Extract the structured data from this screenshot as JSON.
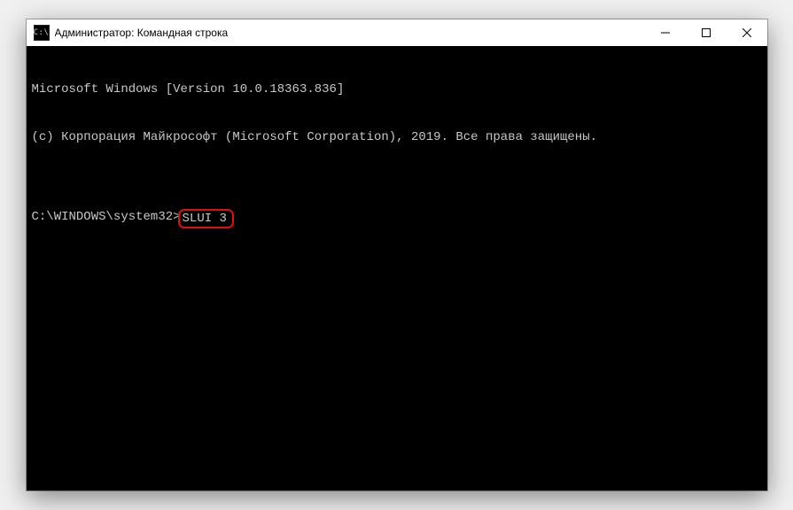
{
  "window": {
    "title": "Администратор: Командная строка",
    "icon_label": "cmd-icon",
    "icon_text": "C:\\"
  },
  "buttons": {
    "minimize": "Minimize",
    "maximize": "Maximize",
    "close": "Close"
  },
  "terminal": {
    "line1": "Microsoft Windows [Version 10.0.18363.836]",
    "line2": "(c) Корпорация Майкрософт (Microsoft Corporation), 2019. Все права защищены.",
    "blank": "",
    "prompt": "C:\\WINDOWS\\system32>",
    "command": "SLUI 3"
  },
  "annotation": {
    "highlight_color": "#d11"
  }
}
